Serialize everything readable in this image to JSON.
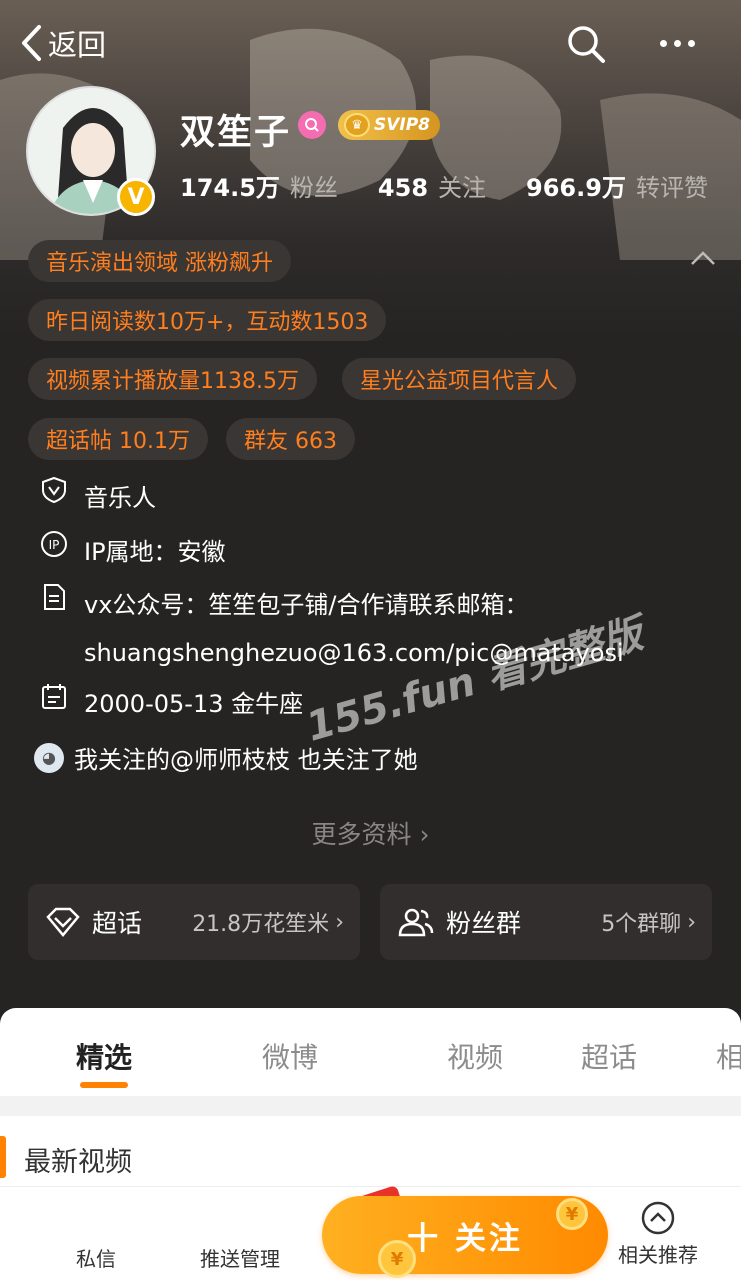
{
  "topbar": {
    "back_label": "返回"
  },
  "profile": {
    "name": "双笙子",
    "svip_label": "SVIP8",
    "stats": [
      {
        "value": "174.5万",
        "label": "粉丝"
      },
      {
        "value": "458",
        "label": "关注"
      },
      {
        "value": "966.9万",
        "label": "转评赞"
      }
    ]
  },
  "tags": [
    "音乐演出领域 涨粉飙升",
    "昨日阅读数10万+，互动数1503",
    "视频累计播放量1138.5万",
    "星光公益项目代言人",
    "超话帖 10.1万",
    "群友 663"
  ],
  "info": {
    "role": "音乐人",
    "ip": "IP属地：安徽",
    "bio_line1": "vx公众号：笙笙包子铺/合作请联系邮箱：",
    "bio_line2": "shuangshenghezuo@163.com/pic@matayosi",
    "birthday": "2000-05-13 金牛座",
    "mutual": "我关注的@师师枝枝 也关注了她"
  },
  "more_info_label": "更多资料",
  "cards": {
    "topic": {
      "title": "超话",
      "value": "21.8万花笙米"
    },
    "fans": {
      "title": "粉丝群",
      "value": "5个群聊"
    }
  },
  "tabs": [
    "精选",
    "微博",
    "视频",
    "超话",
    "相"
  ],
  "section_title": "最新视频",
  "bottom": {
    "message": "私信",
    "push": "推送管理",
    "follow": "十 关注",
    "related": "相关推荐"
  },
  "watermark": "155.fun 看完整版",
  "colors": {
    "accent": "#ff8200",
    "tag_text": "#ff7e1e",
    "bg_dark": "#252423"
  }
}
